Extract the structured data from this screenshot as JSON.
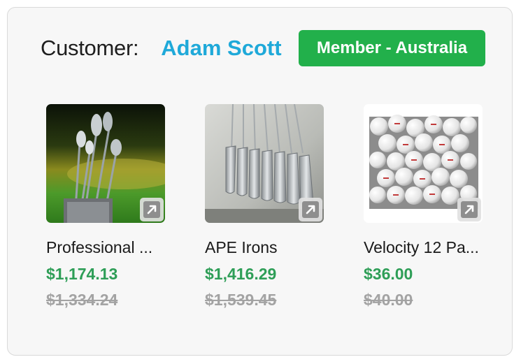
{
  "header": {
    "customer_label": "Customer:",
    "customer_name": "Adam Scott",
    "membership_badge": "Member - Australia"
  },
  "products": [
    {
      "name": "Professional ...",
      "price": "$1,174.13",
      "original_price": "$1,334.24",
      "image": "golf-clubs-in-bag-photo"
    },
    {
      "name": "APE Irons",
      "price": "$1,416.29",
      "original_price": "$1,539.45",
      "image": "iron-clubs-photo"
    },
    {
      "name": "Velocity 12 Pa...",
      "price": "$36.00",
      "original_price": "$40.00",
      "image": "golf-balls-photo"
    }
  ],
  "icons": {
    "expand": "expand-arrow-icon"
  },
  "colors": {
    "customer_name": "#1fa9d9",
    "badge_bg": "#22b04b",
    "price": "#2e9e57",
    "original_price": "#a3a3a3"
  }
}
